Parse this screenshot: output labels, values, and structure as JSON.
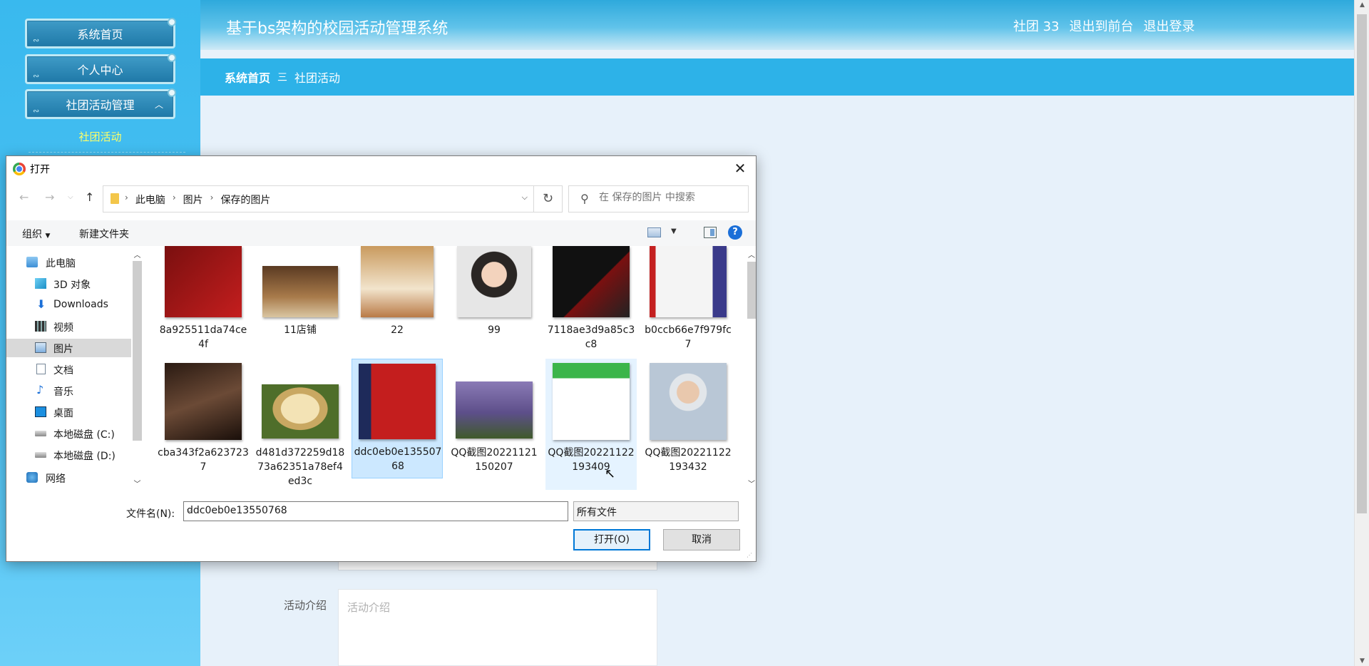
{
  "sidebar": {
    "menu": [
      {
        "label": "系统首页"
      },
      {
        "label": "个人中心"
      },
      {
        "label": "社团活动管理"
      }
    ],
    "submenu_active": "社团活动"
  },
  "header": {
    "title": "基于bs架构的校园活动管理系统",
    "user": "社团 33",
    "frontend_link": "退出到前台",
    "logout_link": "退出登录"
  },
  "breadcrumb": {
    "home": "系统首页",
    "separator": "三",
    "current": "社团活动"
  },
  "form": {
    "intro_label": "活动介绍",
    "intro_placeholder": "活动介绍"
  },
  "dialog": {
    "title": "打开",
    "path": [
      "此电脑",
      "图片",
      "保存的图片"
    ],
    "search_placeholder": "在 保存的图片 中搜索",
    "toolbar": {
      "organize": "组织",
      "new_folder": "新建文件夹"
    },
    "tree": [
      {
        "label": "此电脑",
        "icon": "computer-icon"
      },
      {
        "label": "3D 对象",
        "icon": "3d-objects-icon"
      },
      {
        "label": "Downloads",
        "icon": "download-icon"
      },
      {
        "label": "视频",
        "icon": "video-icon"
      },
      {
        "label": "图片",
        "icon": "pictures-icon",
        "selected": true
      },
      {
        "label": "文档",
        "icon": "document-icon"
      },
      {
        "label": "音乐",
        "icon": "music-icon"
      },
      {
        "label": "桌面",
        "icon": "desktop-icon"
      },
      {
        "label": "本地磁盘 (C:)",
        "icon": "drive-icon"
      },
      {
        "label": "本地磁盘 (D:)",
        "icon": "drive-icon"
      },
      {
        "label": "网络",
        "icon": "network-icon"
      }
    ],
    "files": [
      {
        "name": "8a925511da74ce4f"
      },
      {
        "name": "11店铺"
      },
      {
        "name": "22"
      },
      {
        "name": "99"
      },
      {
        "name": "7118ae3d9a85c3c8"
      },
      {
        "name": "b0ccb66e7f979fc7"
      },
      {
        "name": "cba343f2a6237237"
      },
      {
        "name": "d481d372259d1873a62351a78ef4ed3c"
      },
      {
        "name": "ddc0eb0e13550768",
        "selected": true
      },
      {
        "name": "QQ截图20221121150207"
      },
      {
        "name": "QQ截图20221122193409",
        "hovered": true
      },
      {
        "name": "QQ截图20221122193432"
      }
    ],
    "file_name_label": "文件名(N):",
    "file_name_value": "ddc0eb0e13550768",
    "file_type": "所有文件",
    "open_button": "打开(O)",
    "cancel_button": "取消"
  },
  "colors": {
    "sidebar": "#39b9ee",
    "breadcrumb": "#2db2e8",
    "submenu_active": "#ffff66",
    "selection": "#cce8ff",
    "primary_button_border": "#0078d7"
  }
}
